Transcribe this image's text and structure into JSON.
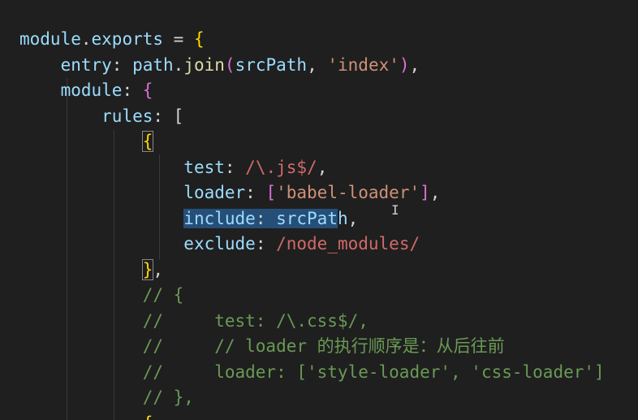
{
  "editor": {
    "lines": [
      [
        {
          "t": "module",
          "c": "tk-prop"
        },
        {
          "t": ".",
          "c": "tk-plain"
        },
        {
          "t": "exports",
          "c": "tk-prop"
        },
        {
          "t": " = ",
          "c": "tk-plain"
        },
        {
          "t": "{",
          "c": "tk-brace"
        }
      ],
      [
        {
          "t": "    "
        },
        {
          "t": "entry",
          "c": "tk-prop"
        },
        {
          "t": ": ",
          "c": "tk-plain"
        },
        {
          "t": "path",
          "c": "tk-var"
        },
        {
          "t": ".",
          "c": "tk-plain"
        },
        {
          "t": "join",
          "c": "tk-func"
        },
        {
          "t": "(",
          "c": "tk-bracket"
        },
        {
          "t": "srcPath",
          "c": "tk-var"
        },
        {
          "t": ", ",
          "c": "tk-plain"
        },
        {
          "t": "'index'",
          "c": "tk-string"
        },
        {
          "t": ")",
          "c": "tk-bracket"
        },
        {
          "t": ",",
          "c": "tk-plain"
        }
      ],
      [
        {
          "t": "    "
        },
        {
          "t": "module",
          "c": "tk-prop"
        },
        {
          "t": ": ",
          "c": "tk-plain"
        },
        {
          "t": "{",
          "c": "tk-bracket"
        }
      ],
      [
        {
          "t": "        "
        },
        {
          "t": "rules",
          "c": "tk-prop"
        },
        {
          "t": ": ",
          "c": "tk-plain"
        },
        {
          "t": "[",
          "c": "tk-plain"
        }
      ],
      [
        {
          "t": "            "
        },
        {
          "t": "{",
          "c": "tk-brace",
          "box": true
        }
      ],
      [
        {
          "t": "                "
        },
        {
          "t": "test",
          "c": "tk-prop"
        },
        {
          "t": ": ",
          "c": "tk-plain"
        },
        {
          "t": "/\\.js$/",
          "c": "tk-regex"
        },
        {
          "t": ",",
          "c": "tk-plain"
        }
      ],
      [
        {
          "t": "                "
        },
        {
          "t": "loader",
          "c": "tk-prop"
        },
        {
          "t": ": ",
          "c": "tk-plain"
        },
        {
          "t": "[",
          "c": "tk-bracket"
        },
        {
          "t": "'babel-loader'",
          "c": "tk-string"
        },
        {
          "t": "]",
          "c": "tk-bracket"
        },
        {
          "t": ",",
          "c": "tk-plain"
        }
      ],
      [
        {
          "t": "                "
        },
        {
          "t": "include",
          "c": "tk-prop",
          "hl": true
        },
        {
          "t": ": ",
          "c": "tk-plain",
          "hl": true
        },
        {
          "t": "srcPat",
          "c": "tk-var",
          "hl": true
        },
        {
          "t": "h",
          "c": "tk-var"
        },
        {
          "t": ",",
          "c": "tk-plain"
        }
      ],
      [
        {
          "t": "                "
        },
        {
          "t": "exclude",
          "c": "tk-prop"
        },
        {
          "t": ": ",
          "c": "tk-plain"
        },
        {
          "t": "/node_modules/",
          "c": "tk-regex"
        }
      ],
      [
        {
          "t": "            "
        },
        {
          "t": "}",
          "c": "tk-brace",
          "box": true
        },
        {
          "t": ",",
          "c": "tk-plain"
        }
      ],
      [
        {
          "t": "            "
        },
        {
          "t": "// {",
          "c": "tk-comment"
        }
      ],
      [
        {
          "t": "            "
        },
        {
          "t": "//     test: /\\.css$/,",
          "c": "tk-comment"
        }
      ],
      [
        {
          "t": "            "
        },
        {
          "t": "//     // loader 的执行顺序是：从后往前",
          "c": "tk-comment"
        }
      ],
      [
        {
          "t": "            "
        },
        {
          "t": "//     loader: ['style-loader', 'css-loader']",
          "c": "tk-comment"
        }
      ],
      [
        {
          "t": "            "
        },
        {
          "t": "// },",
          "c": "tk-comment"
        }
      ],
      [
        {
          "t": "            "
        },
        {
          "t": "{",
          "c": "tk-brace"
        }
      ]
    ],
    "cursor_glyph": "I"
  }
}
